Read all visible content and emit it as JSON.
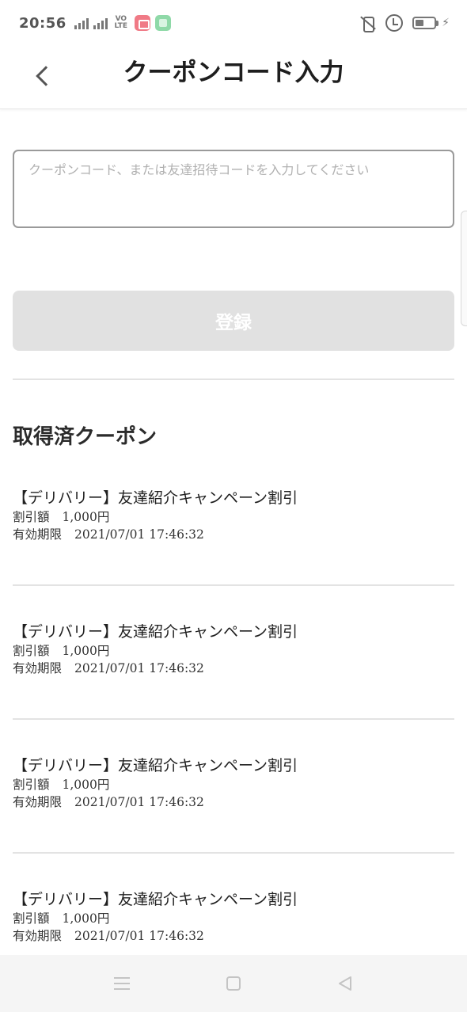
{
  "status_bar": {
    "time": "20:56",
    "network_label": "VO LTE",
    "battery_percent": 45
  },
  "header": {
    "title": "クーポンコード入力"
  },
  "coupon_input": {
    "value": "",
    "placeholder": "クーポンコード、または友達招待コードを入力してください"
  },
  "register_button": {
    "label": "登録"
  },
  "acquired": {
    "title": "取得済クーポン",
    "items": [
      {
        "name": "【デリバリー】友達紹介キャンペーン割引",
        "discount_label": "割引額",
        "discount": "1,000円",
        "expiry_label": "有効期限",
        "expiry": "2021/07/01 17:46:32"
      },
      {
        "name": "【デリバリー】友達紹介キャンペーン割引",
        "discount_label": "割引額",
        "discount": "1,000円",
        "expiry_label": "有効期限",
        "expiry": "2021/07/01 17:46:32"
      },
      {
        "name": "【デリバリー】友達紹介キャンペーン割引",
        "discount_label": "割引額",
        "discount": "1,000円",
        "expiry_label": "有効期限",
        "expiry": "2021/07/01 17:46:32"
      },
      {
        "name": "【デリバリー】友達紹介キャンペーン割引",
        "discount_label": "割引額",
        "discount": "1,000円",
        "expiry_label": "有効期限",
        "expiry": "2021/07/01 17:46:32"
      }
    ]
  },
  "colors": {
    "button_disabled": "#e1e1e1",
    "divider": "#e3e3e3",
    "nav_bar": "#f5f5f5"
  },
  "icons": {
    "back": "chevron-left-icon",
    "nav_menu": "menu-icon",
    "nav_home": "square-home-icon",
    "nav_back": "triangle-back-icon"
  }
}
